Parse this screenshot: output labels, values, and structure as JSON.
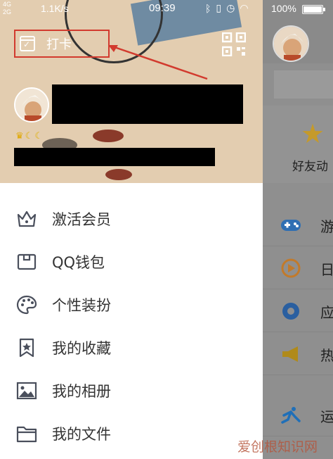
{
  "status_bar": {
    "network_line1": "4G",
    "network_line2": "2G",
    "speed": "1.1K/s",
    "time": "09:39",
    "battery_percent": "100%"
  },
  "drawer": {
    "checkin_label": "打卡",
    "menu": [
      {
        "label": "激活会员",
        "icon": "crown-icon"
      },
      {
        "label": "QQ钱包",
        "icon": "wallet-icon"
      },
      {
        "label": "个性装扮",
        "icon": "palette-icon"
      },
      {
        "label": "我的收藏",
        "icon": "bookmark-star-icon"
      },
      {
        "label": "我的相册",
        "icon": "photo-album-icon"
      },
      {
        "label": "我的文件",
        "icon": "folder-icon"
      }
    ]
  },
  "main_peek": {
    "card_label": "好友动",
    "rows": [
      {
        "label": "游",
        "icon": "gamepad-icon",
        "color": "#2f6fb3"
      },
      {
        "label": "日",
        "icon": "live-icon",
        "color": "#c27a2a"
      },
      {
        "label": "应",
        "icon": "app-icon",
        "color": "#2a5fa0"
      },
      {
        "label": "热",
        "icon": "megaphone-icon",
        "color": "#b08a1a"
      },
      {
        "label": "运",
        "icon": "sport-icon",
        "color": "#1f6fb8"
      }
    ]
  },
  "watermark": "爱创根知识网",
  "colors": {
    "accent_red": "#d23a2e",
    "header_bg": "#e3cdb0",
    "icon_gray": "#4a4f5c"
  }
}
